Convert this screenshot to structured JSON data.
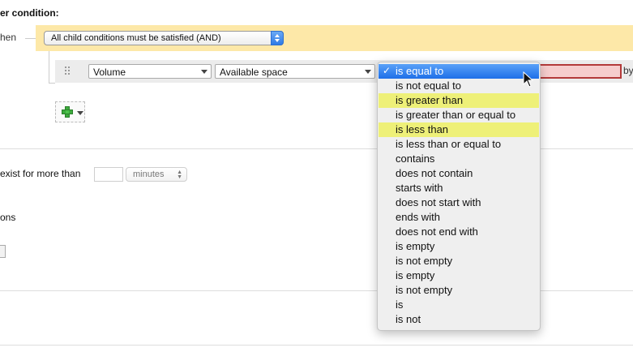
{
  "section_title": "er condition:",
  "when_label": "hen",
  "condition_group": {
    "logic_select": "All child conditions must be satisfied (AND)"
  },
  "rule": {
    "field": "Volume",
    "attribute": "Available space",
    "operator": "is equal to",
    "value": "",
    "suffix_label": "by"
  },
  "add_button": {
    "icon": "add-plus-icon"
  },
  "exist": {
    "label": "exist for more than",
    "value": "",
    "unit": "minutes"
  },
  "ons_label": "ons",
  "operator_options": [
    "is equal to",
    "is not equal to",
    "is greater than",
    "is greater than or equal to",
    "is less than",
    "is less than or equal to",
    "contains",
    "does not contain",
    "starts with",
    "does not start with",
    "ends with",
    "does not end with",
    "is empty",
    "is not empty",
    "is empty",
    "is not empty",
    "is",
    "is not"
  ],
  "selected_option_index": 0,
  "highlighted_option_indices": [
    2,
    4
  ],
  "colors": {
    "condition_bar": "#fde8a8",
    "selected_option": "#1e6fe8",
    "highlight": "#eef078",
    "invalid_input": "#f6cdcd"
  }
}
